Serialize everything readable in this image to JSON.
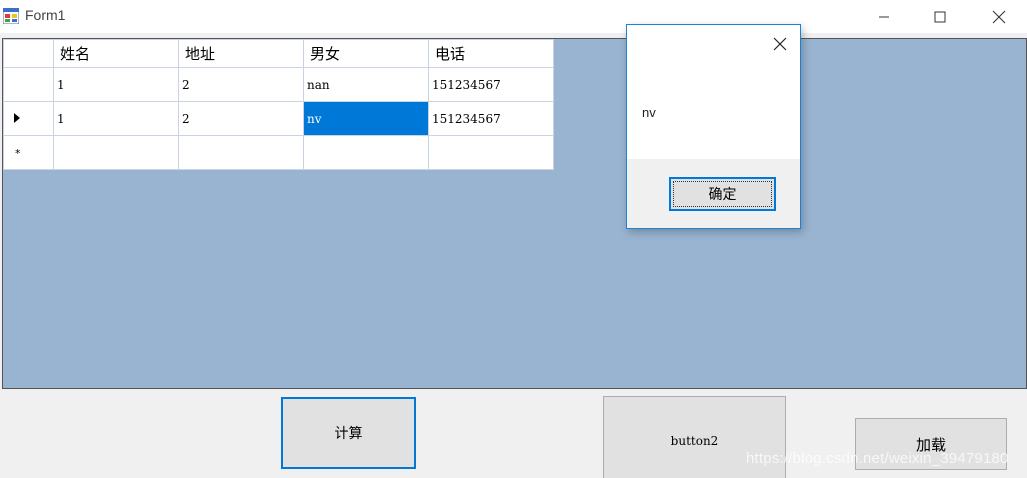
{
  "window": {
    "title": "Form1"
  },
  "icons": {
    "app": "form-app-icon",
    "minimize": "minimize-icon",
    "maximize": "maximize-icon",
    "close": "close-icon",
    "current_row": "row-arrow-icon",
    "new_row": "new-row-icon"
  },
  "grid": {
    "columns": [
      "姓名",
      "地址",
      "男女",
      "电话"
    ],
    "rows": [
      {
        "cells": [
          "1",
          "2",
          "nan",
          "151234567"
        ]
      },
      {
        "cells": [
          "1",
          "2",
          "nv",
          "151234567"
        ]
      },
      {
        "cells": [
          "",
          "",
          "",
          ""
        ]
      }
    ],
    "new_row_marker": "*"
  },
  "buttons": {
    "calc_label": "计算",
    "button2_label": "button2",
    "load_label": "加载"
  },
  "message_box": {
    "text": "nv",
    "ok_label": "确定"
  },
  "watermark": "https://blog.csdn.net/weixin_39479180",
  "colors": {
    "grid_background": "#99b4d1",
    "selection": "#0078d7",
    "accent_border": "#0078d7"
  }
}
